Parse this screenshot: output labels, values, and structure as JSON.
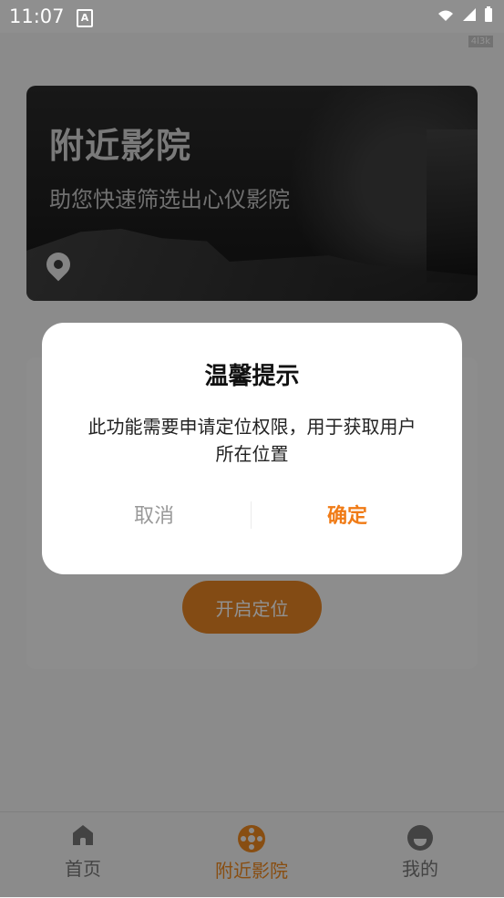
{
  "status": {
    "time": "11:07",
    "a_label": "A",
    "badge": "4l3k"
  },
  "banner": {
    "title": "附近影院",
    "subtitle": "助您快速筛选出心仪影院"
  },
  "location_button": {
    "label": "开启定位"
  },
  "dialog": {
    "title": "温馨提示",
    "message": "此功能需要申请定位权限，用于获取用户所在位置",
    "cancel": "取消",
    "confirm": "确定"
  },
  "bottom_nav": {
    "items": [
      {
        "label": "首页"
      },
      {
        "label": "附近影院"
      },
      {
        "label": "我的"
      }
    ]
  },
  "colors": {
    "accent": "#f08a20",
    "cancel": "#999999",
    "overlay": "rgba(0,0,0,0.43)"
  }
}
